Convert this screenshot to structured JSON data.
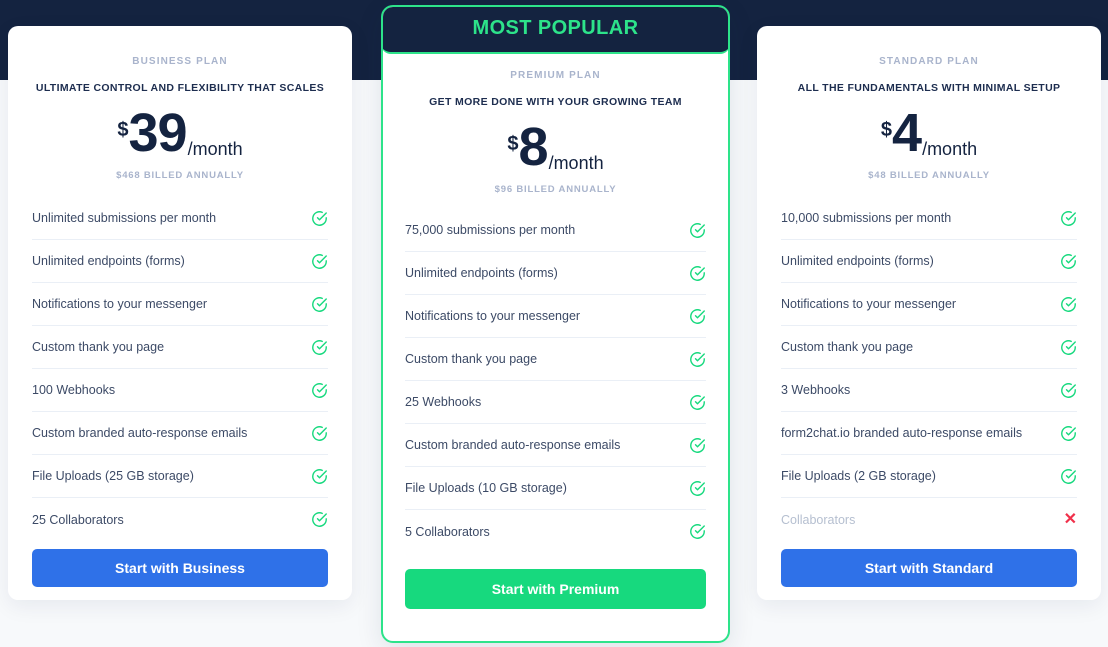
{
  "theme": {
    "dark_navy": "#142340",
    "page_bg": "#f7f9fb",
    "accent_green": "#2de38a",
    "accent_blue": "#2f71e8",
    "check_green": "#17d97e",
    "x_red": "#f0304a"
  },
  "badge": {
    "label": "MOST POPULAR"
  },
  "plans": [
    {
      "id": "business",
      "name": "BUSINESS PLAN",
      "tagline": "ULTIMATE CONTROL AND FLEXIBILITY THAT SCALES",
      "currency": "$",
      "amount": "39",
      "period": "/month",
      "billed": "$468 BILLED ANNUALLY",
      "cta": "Start with Business",
      "features": [
        {
          "label": "Unlimited submissions per month",
          "included": true
        },
        {
          "label": "Unlimited endpoints (forms)",
          "included": true
        },
        {
          "label": "Notifications to your messenger",
          "included": true
        },
        {
          "label": "Custom thank you page",
          "included": true
        },
        {
          "label": "100 Webhooks",
          "included": true
        },
        {
          "label": "Custom branded auto-response emails",
          "included": true
        },
        {
          "label": "File Uploads (25 GB storage)",
          "included": true
        },
        {
          "label": "25 Collaborators",
          "included": true
        }
      ]
    },
    {
      "id": "premium",
      "name": "PREMIUM PLAN",
      "tagline": "GET MORE DONE WITH YOUR GROWING TEAM",
      "currency": "$",
      "amount": "8",
      "period": "/month",
      "billed": "$96 BILLED ANNUALLY",
      "cta": "Start with Premium",
      "features": [
        {
          "label": "75,000 submissions per month",
          "included": true
        },
        {
          "label": "Unlimited endpoints (forms)",
          "included": true
        },
        {
          "label": "Notifications to your messenger",
          "included": true
        },
        {
          "label": "Custom thank you page",
          "included": true
        },
        {
          "label": "25 Webhooks",
          "included": true
        },
        {
          "label": "Custom branded auto-response emails",
          "included": true
        },
        {
          "label": "File Uploads (10 GB storage)",
          "included": true
        },
        {
          "label": "5 Collaborators",
          "included": true
        }
      ]
    },
    {
      "id": "standard",
      "name": "STANDARD PLAN",
      "tagline": "ALL THE FUNDAMENTALS WITH MINIMAL SETUP",
      "currency": "$",
      "amount": "4",
      "period": "/month",
      "billed": "$48 BILLED ANNUALLY",
      "cta": "Start with Standard",
      "features": [
        {
          "label": "10,000 submissions per month",
          "included": true
        },
        {
          "label": "Unlimited endpoints (forms)",
          "included": true
        },
        {
          "label": "Notifications to your messenger",
          "included": true
        },
        {
          "label": "Custom thank you page",
          "included": true
        },
        {
          "label": "3 Webhooks",
          "included": true
        },
        {
          "label": "form2chat.io branded auto-response emails",
          "included": true
        },
        {
          "label": "File Uploads (2 GB storage)",
          "included": true
        },
        {
          "label": "Collaborators",
          "included": false
        }
      ]
    }
  ]
}
